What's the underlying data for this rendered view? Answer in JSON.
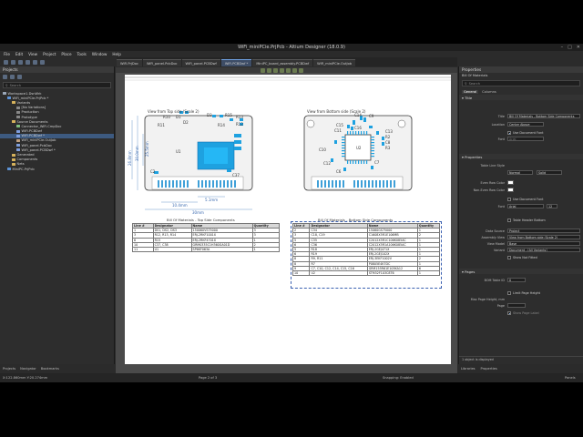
{
  "window": {
    "title": "WiFi_miniPCie.PrjPcb - Altium Designer (18.0.9)"
  },
  "menu": [
    "File",
    "Edit",
    "View",
    "Project",
    "Place",
    "Tools",
    "Window",
    "Help"
  ],
  "tabs": [
    {
      "label": "WiFi.PrjDoc",
      "active": false
    },
    {
      "label": "WiFi_panel.PcbDoc",
      "active": false
    },
    {
      "label": "WiFi_panel.PCBDwf",
      "active": false
    },
    {
      "label": "WiFi.PCBDwf *",
      "active": true
    },
    {
      "label": "MiniPC_board_assembly.PCBDwf",
      "active": false
    },
    {
      "label": "WiFi_miniPCie.OutJob",
      "active": false
    }
  ],
  "projects_panel": {
    "title": "Projects",
    "search_placeholder": "Search",
    "tree": [
      {
        "label": "Workspace1.DsnWrk",
        "level": 0,
        "color": "#9aa7b8"
      },
      {
        "label": "WiFi_miniPCie.PrjPcb *",
        "level": 1,
        "color": "#5c93d6",
        "sel": false
      },
      {
        "label": "Variants",
        "level": 2,
        "color": "#d6b25c"
      },
      {
        "label": "[No Variations]",
        "level": 3,
        "color": "#888"
      },
      {
        "label": "Production",
        "level": 3,
        "color": "#888"
      },
      {
        "label": "Prototype",
        "level": 3,
        "color": "#888"
      },
      {
        "label": "Source Documents",
        "level": 2,
        "color": "#d6b25c"
      },
      {
        "label": "Connector_WiFi.CmpDoc",
        "level": 3,
        "color": "#7fbf7f"
      },
      {
        "label": "WiFi.PCBDwf",
        "level": 3,
        "color": "#7f9fdf"
      },
      {
        "label": "WiFi.PCBDwf *",
        "level": 3,
        "color": "#7f9fdf",
        "sel": true
      },
      {
        "label": "WiFi_miniPCie.OutJob",
        "level": 3,
        "color": "#bf9f7f"
      },
      {
        "label": "WiFi_panel.PcbDoc",
        "level": 3,
        "color": "#7f9fdf"
      },
      {
        "label": "WiFi_panel.PCBDwf *",
        "level": 3,
        "color": "#7f9fdf"
      },
      {
        "label": "Generated",
        "level": 2,
        "color": "#d6b25c"
      },
      {
        "label": "Components",
        "level": 2,
        "color": "#d6b25c"
      },
      {
        "label": "Nets",
        "level": 2,
        "color": "#d6b25c"
      },
      {
        "label": "MiniPC.PrjPcb",
        "level": 1,
        "color": "#5c93d6"
      }
    ],
    "bottom_tabs": [
      "Projects",
      "Navigator",
      "Bookmarks"
    ]
  },
  "drawing": {
    "top_view_label": "View from Top side (Scale 2)",
    "bottom_view_label": "View from Bottom side (Scale 2)",
    "dims": {
      "d1": "26.8mm",
      "d2": "30.0mm",
      "d3": "25.5mm",
      "d4": "10.4mm",
      "d5": "5.1mm",
      "d6": "30mm"
    },
    "top_refs": {
      "r10": "R10",
      "r11": "R11",
      "d1": "D1",
      "d2": "D2",
      "d3": "D3",
      "r14": "R14",
      "r15": "R15",
      "r13": "R13",
      "r12": "R12",
      "u1": "U1",
      "c2": "C2",
      "c37": "C37"
    },
    "bottom_refs": {
      "c14": "C14",
      "c9": "C9",
      "c11": "C11",
      "c15": "C15",
      "c16": "C16",
      "c13": "C13",
      "r2": "R2",
      "c8": "C8",
      "r3": "R3",
      "c10": "C10",
      "u2": "U2",
      "c7": "C7",
      "c12": "C12",
      "c6": "C6"
    },
    "top_table": {
      "title": "Bill Of Materials - Top Side Components",
      "headers": [
        "Line #",
        "Designator",
        "Name",
        "Quantity"
      ],
      "rows": [
        [
          "1",
          "DS1, DS2, DS3",
          "150060VS75000",
          "3"
        ],
        [
          "3",
          "R12, R13, R14",
          "ERJ-2RKF1001X",
          "3"
        ],
        [
          "6",
          "R15",
          "ERJ-2RKF4701X",
          "1"
        ],
        [
          "10",
          "C37, C38",
          "GRM0335C1H360GA01D",
          "2"
        ],
        [
          "11",
          "U1",
          "SP6KF063A",
          "1"
        ]
      ]
    },
    "bottom_table": {
      "title": "Bill Of Materials - Bottom Side Components",
      "headers": [
        "Line #",
        "Designator",
        "Name",
        "Quantity"
      ],
      "rows": [
        [
          "2",
          "C34",
          "15060GS75000",
          "1"
        ],
        [
          "3",
          "C18, C19",
          "C1608X5R1E106MB",
          "2"
        ],
        [
          "5",
          "C35",
          "C2012X5R1C106K085AC",
          "1"
        ],
        [
          "6",
          "C36",
          "C2012X5R1A106K085AC",
          "1"
        ],
        [
          "5",
          "R18",
          "ERJ-2GEJ471X",
          "1"
        ],
        [
          "6",
          "R19",
          "ERJ-2GEJ102X",
          "1"
        ],
        [
          "8",
          "R9, R11",
          "ERJ-3EKF1002V",
          "2"
        ],
        [
          "8",
          "R7",
          "P0805E4K7DC",
          "1"
        ],
        [
          "9",
          "C7, C10, C12, C14, C15, C16",
          "GRM155R61E105KA12",
          "6"
        ],
        [
          "10",
          "U2",
          "STM32F103C8T6",
          "1"
        ]
      ]
    }
  },
  "properties_panel": {
    "title": "Properties",
    "object": "Bill Of Materials",
    "search_placeholder": "Search",
    "tabs": [
      "General",
      "Columns"
    ],
    "title_section": "Title",
    "title_value": "Bill Of Materials - Bottom Side Components",
    "location_label": "Location",
    "location_value": "Center Above",
    "use_doc_font": "Use Document Font",
    "font_label": "Font",
    "font_value": "Arial",
    "properties_section": "Properties",
    "table_line_style_label": "Table Line Style",
    "table_line_value": "Normal",
    "table_line_style2": "Solid",
    "even_row_label": "Even Row Color",
    "non_even_row_label": "Non-Even Row Color",
    "use_doc_font2": "Use Document Font",
    "font2_value": "Arial",
    "font2_size": "12",
    "table_header_bottom": "Table Header Bottom",
    "data_source_label": "Data Source",
    "data_source_value": "Project",
    "assembly_view_label": "Assembly View",
    "assembly_view_value": "View from Bottom side (Scale 2)",
    "view_mode_label": "View Model",
    "view_mode_value": "Base",
    "variant_label": "Variant",
    "variant_value": "Document - [All Variants]",
    "show_not_fitted": "Show Not Fitted",
    "pages_section": "Pages",
    "bom_table_id_label": "BOM Table ID",
    "bom_table_id_value": "0",
    "limit_page_height": "Limit Page Height",
    "max_page_height_label": "Max Page Height, mm",
    "page_label": "Page",
    "show_page_label": "Show Page Label",
    "selection_info": "1 object is displayed",
    "bottom_tabs": [
      "Libraries",
      "Properties"
    ]
  },
  "status": {
    "coords": "X:122.860mm Y:20.274mm",
    "page": "Page 2 of 3",
    "snapping": "Snapping: Enabled",
    "panels": "Panels"
  }
}
